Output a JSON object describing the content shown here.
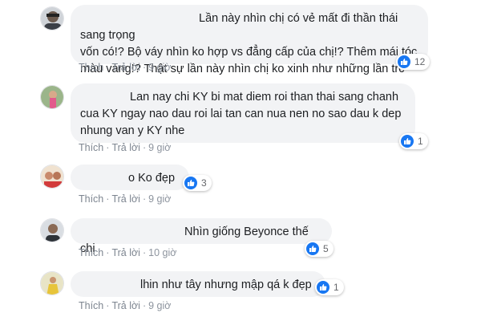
{
  "actions": {
    "like": "Thích",
    "reply": "Trả lời",
    "separator": "·"
  },
  "colors": {
    "bubble": "#f2f3f5",
    "link": "#7d8590",
    "like_blue": "#1877f2"
  },
  "comments": [
    {
      "text_line1": "Lần này nhìn chị có vẻ mất đi thần thái sang trọng",
      "text_line2": "vốn có!? Bộ váy nhìn ko hợp vs đẳng cấp của chị!? Thêm mái tóc",
      "text_line3": "màu vàng!? Thật sự lần này nhìn chị ko xinh như những lần trc",
      "time": "9 giờ",
      "reactions": "12",
      "reaction_icon": "thumbs-up-icon"
    },
    {
      "text_line1": "Lan nay chi KY bi mat diem roi than thai sang chanh",
      "text_line2": "cua KY ngay nao dau roi lai tan can nua nen no sao dau k dep",
      "text_line3": "nhung van y KY nhe",
      "time": "9 giờ",
      "reactions": "1",
      "reaction_icon": "thumbs-up-icon"
    },
    {
      "text": "o Ko đẹp",
      "time": "9 giờ",
      "reactions": "3",
      "reaction_icon": "thumbs-up-icon"
    },
    {
      "text": "Nhìn giống Beyonce thế chị",
      "time": "10 giờ",
      "reactions": "5",
      "reaction_icon": "thumbs-up-icon"
    },
    {
      "text": "lhin như tây nhưng mập qá k đẹp",
      "time": "9 giờ",
      "reactions": "1",
      "reaction_icon": "thumbs-up-icon"
    }
  ]
}
